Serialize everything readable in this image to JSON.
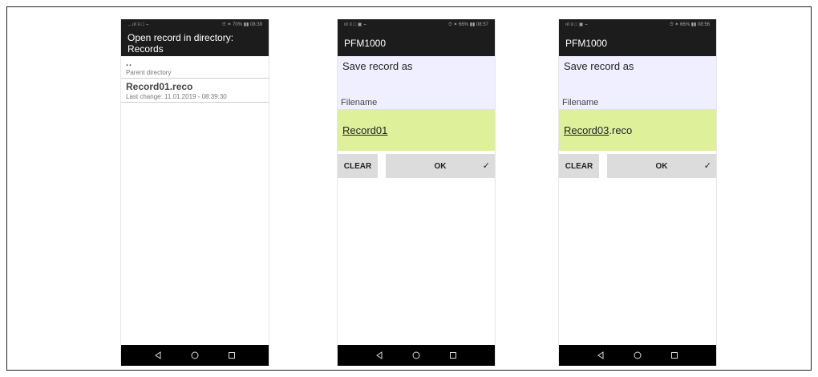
{
  "screens": [
    {
      "status_left": "…ııl ≡ □ ⌣",
      "status_right": "⏱ ✶ 70% ▮▮ 08:39",
      "title": "Open record in directory: Records",
      "items": [
        {
          "name": "..",
          "detail": "Parent directory"
        },
        {
          "name": "Record01.reco",
          "detail": "Last change: 11.01.2019 - 08:39:30"
        }
      ]
    },
    {
      "status_left": "ııl ≡ □ ▣ ⌣",
      "status_right": "⏱ ✶ 66% ▮▮ 08:57",
      "title": "PFM1000",
      "save_title": "Save record as",
      "filename_label": "Filename",
      "filename": "Record01",
      "extension": "",
      "clear_label": "CLEAR",
      "ok_label": "OK",
      "check_icon": "check-icon"
    },
    {
      "status_left": "ııl ≡ □ ▣ ⌣",
      "status_right": "⏱ ✶ 66% ▮▮ 08:56",
      "title": "PFM1000",
      "save_title": "Save record as",
      "filename_label": "Filename",
      "filename": "Record03",
      "extension": ".reco",
      "clear_label": "CLEAR",
      "ok_label": "OK",
      "check_icon": "check-icon"
    }
  ],
  "navbar": {
    "back_icon": "back-icon",
    "home_icon": "home-icon",
    "recents_icon": "recents-icon"
  }
}
